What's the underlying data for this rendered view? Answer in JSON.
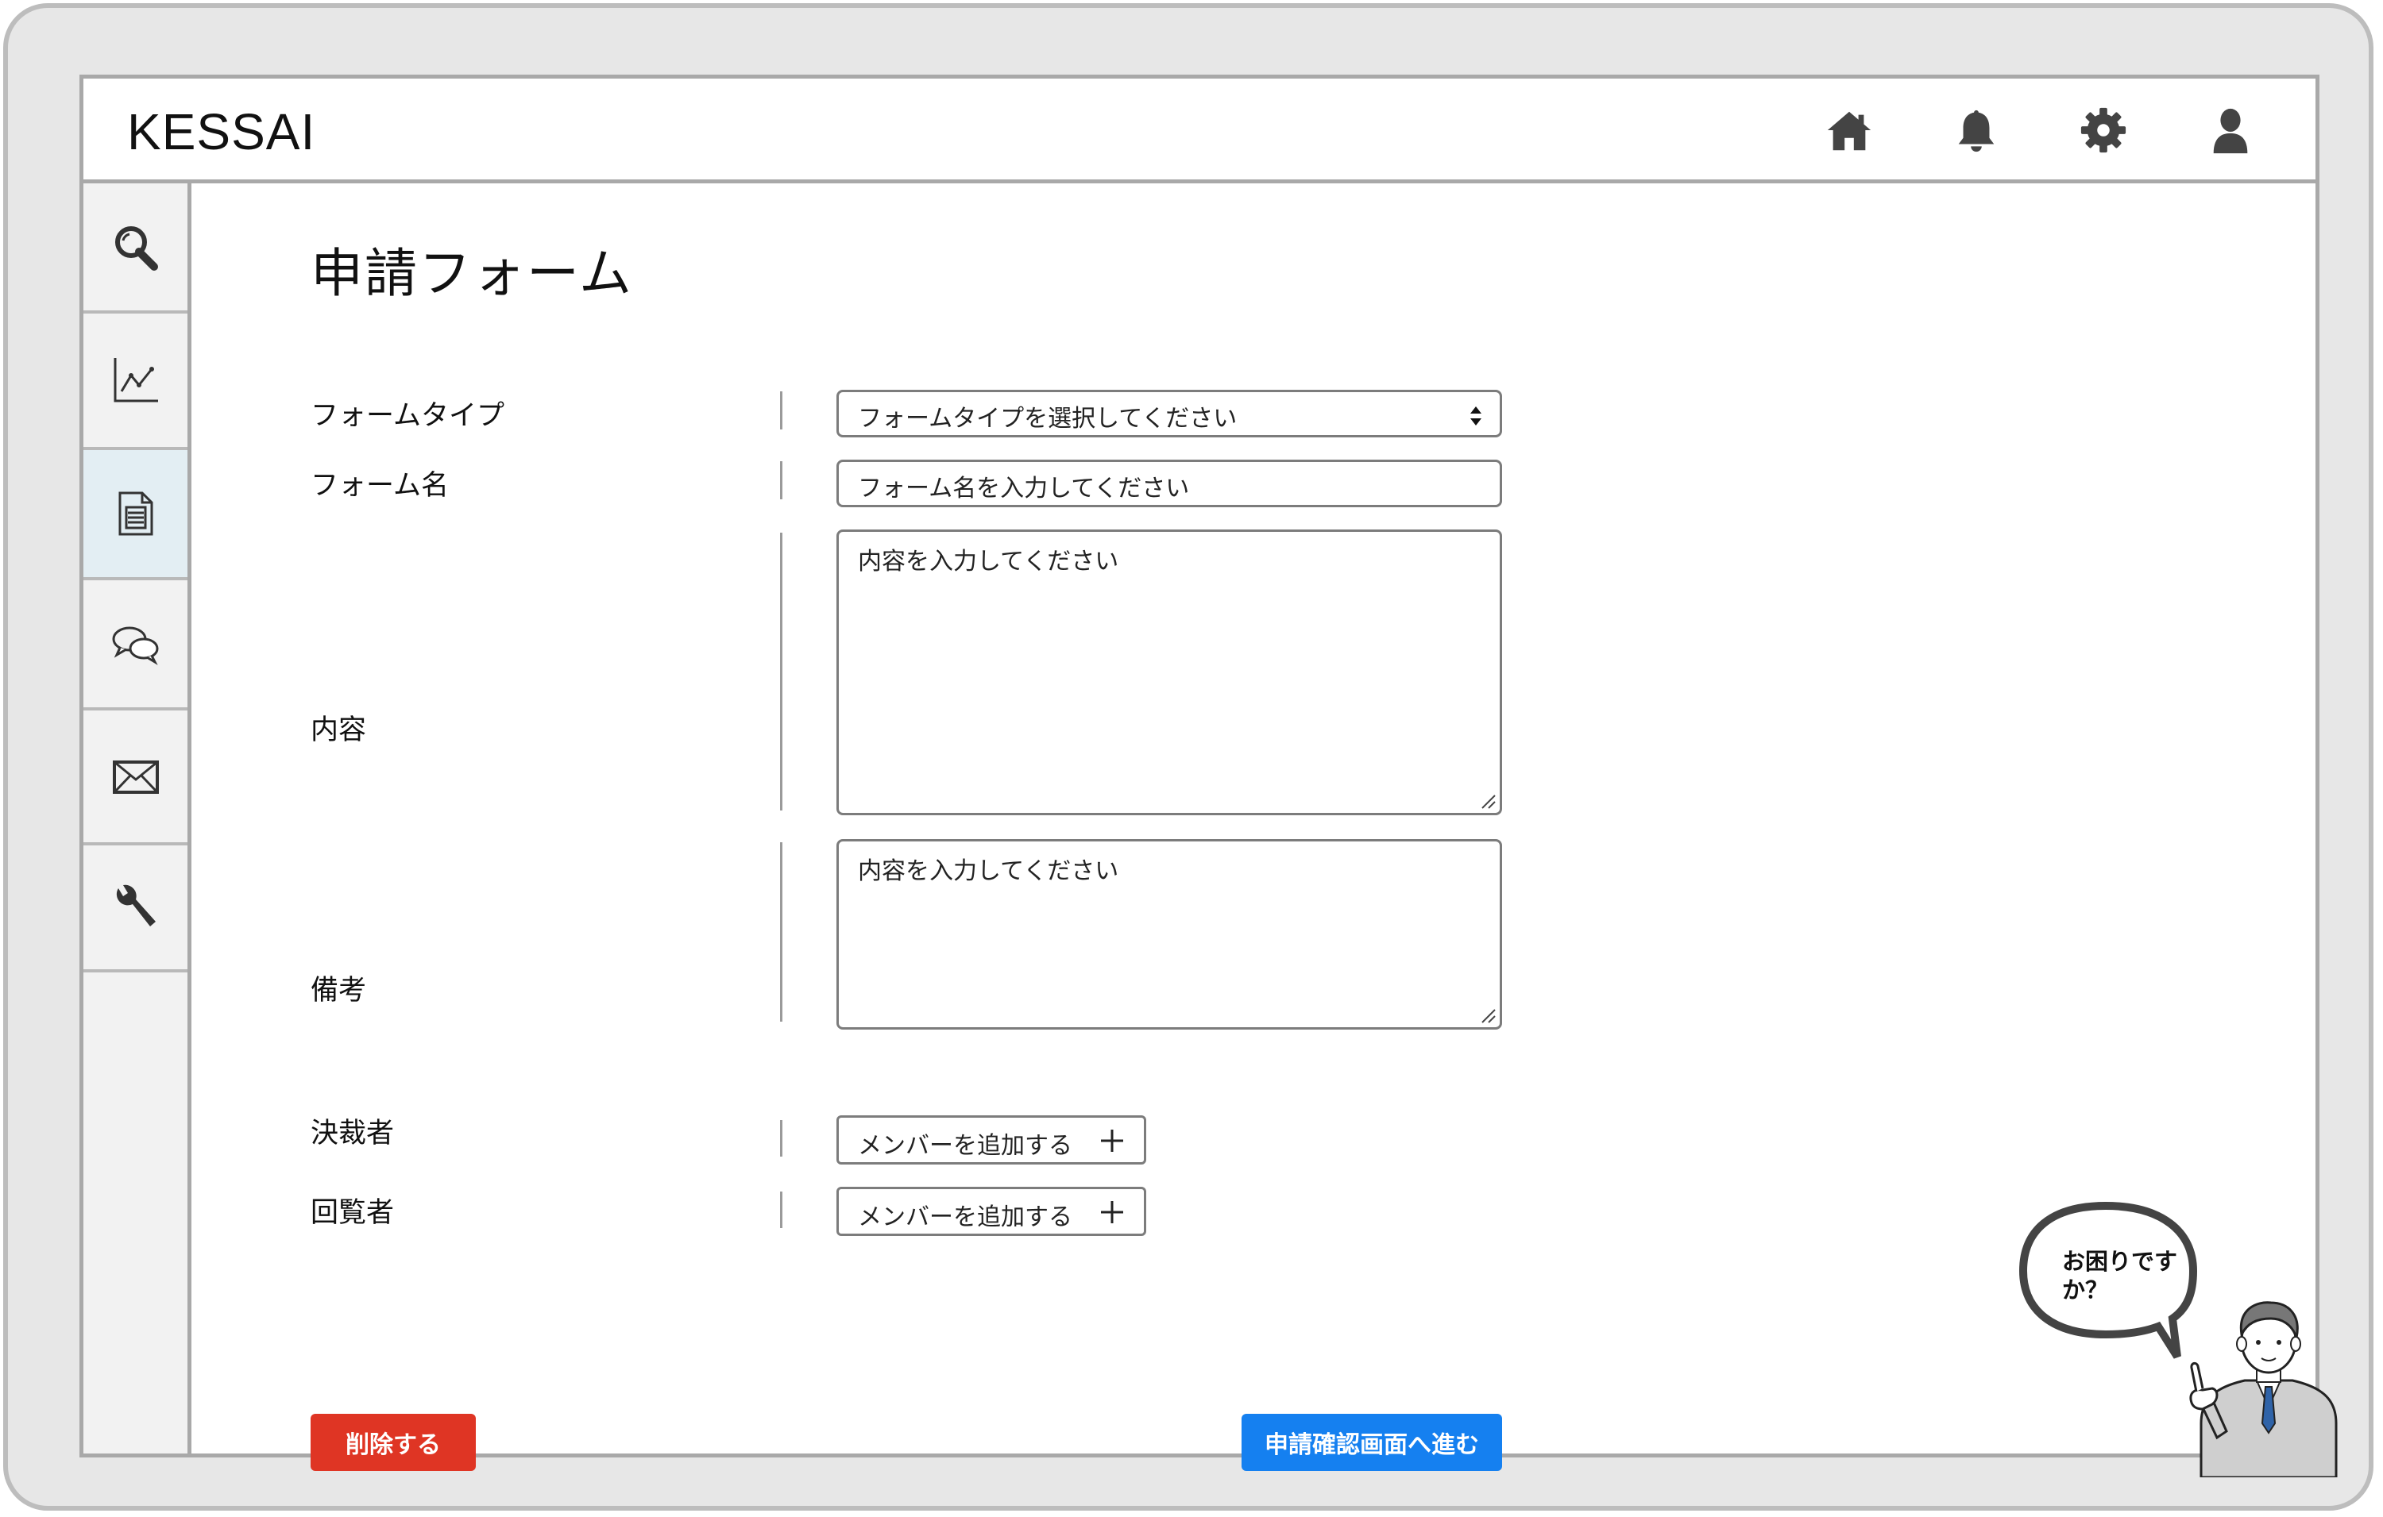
{
  "app": {
    "title": "KESSAI"
  },
  "header_icons": [
    "home-icon",
    "bell-icon",
    "gear-icon",
    "user-icon"
  ],
  "sidebar": {
    "items": [
      {
        "icon": "search-icon"
      },
      {
        "icon": "chart-icon"
      },
      {
        "icon": "document-icon",
        "active": true
      },
      {
        "icon": "chat-icon"
      },
      {
        "icon": "mail-icon"
      },
      {
        "icon": "wrench-icon"
      }
    ]
  },
  "page": {
    "title": "申請フォーム"
  },
  "form": {
    "form_type": {
      "label": "フォームタイプ",
      "placeholder": "フォームタイプを選択してください"
    },
    "form_name": {
      "label": "フォーム名",
      "placeholder": "フォーム名を入力してください"
    },
    "content": {
      "label": "内容",
      "placeholder": "内容を入力してください"
    },
    "remarks": {
      "label": "備考",
      "placeholder": "内容を入力してください"
    },
    "approver": {
      "label": "決裁者",
      "button": "メンバーを追加する"
    },
    "viewer": {
      "label": "回覧者",
      "button": "メンバーを追加する"
    }
  },
  "actions": {
    "delete": "削除する",
    "next": "申請確認画面へ進む"
  },
  "help": {
    "bubble": "お困りですか？"
  },
  "colors": {
    "delete": "#df3524",
    "primary": "#1580f0",
    "active_sidebar": "#e3eef3"
  }
}
